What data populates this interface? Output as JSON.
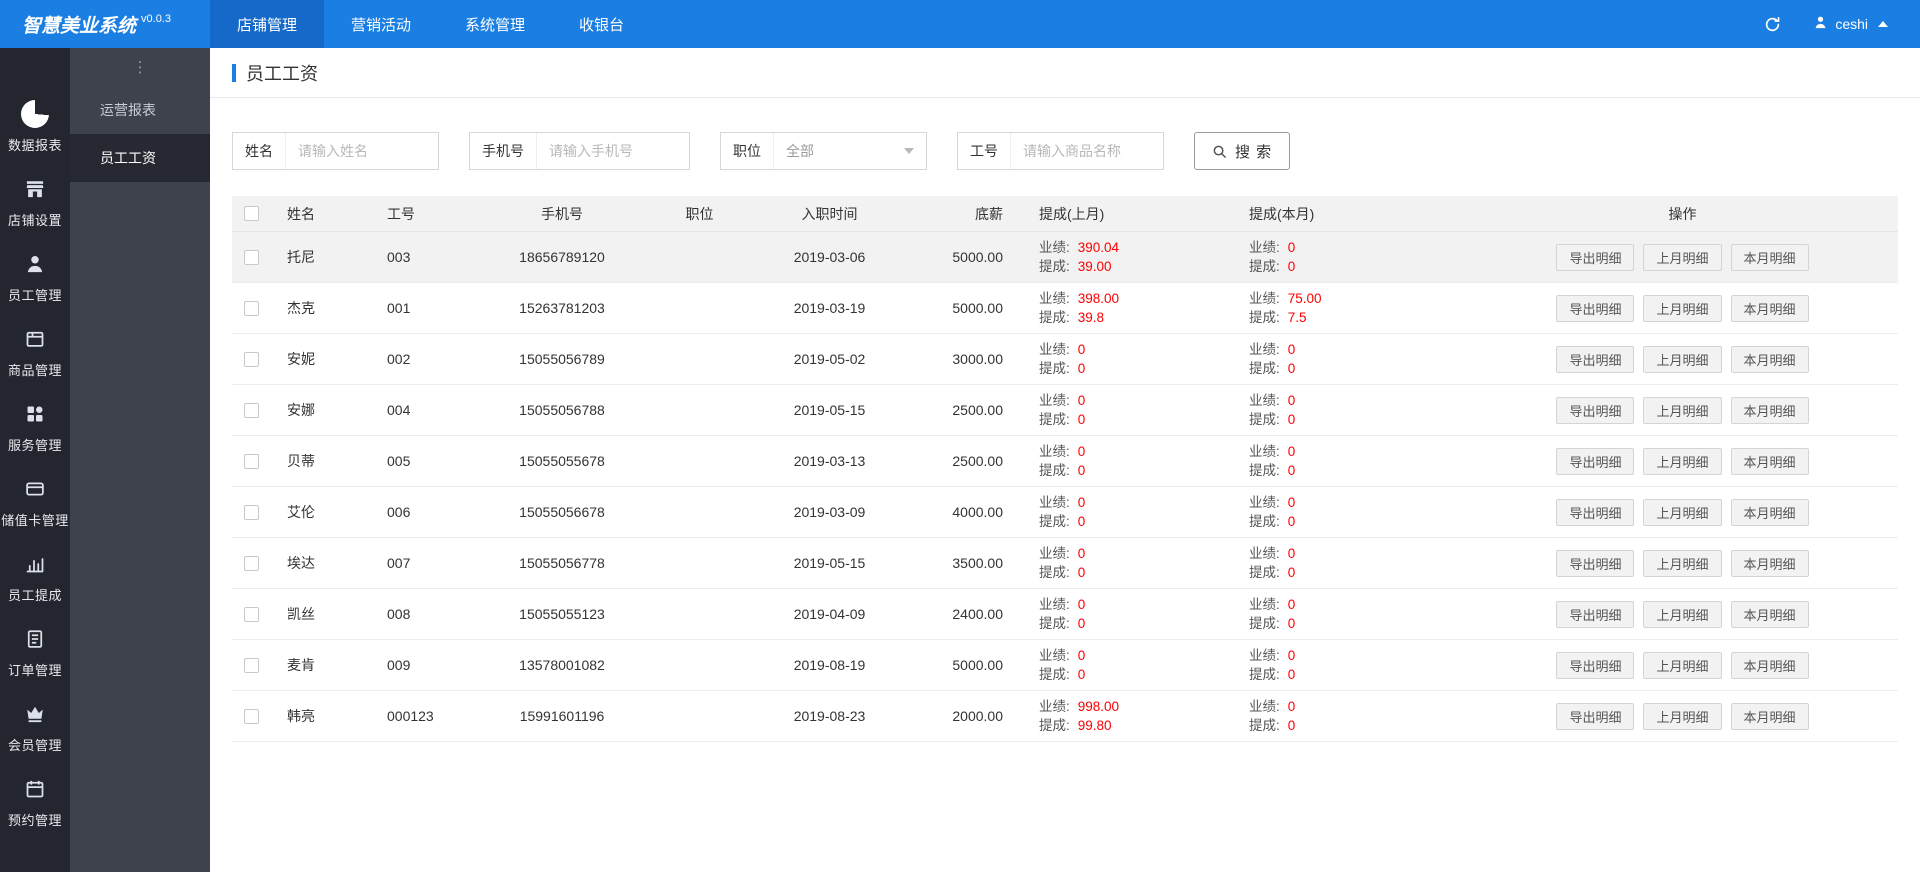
{
  "app": {
    "title": "智慧美业系统",
    "version": "v0.0.3",
    "user": "ceshi"
  },
  "colors": {
    "primary": "#1a7ee2",
    "primary_dark": "#1469c9",
    "sidebar_bg": "#23262e",
    "submenu_bg": "#3d424d",
    "danger_value": "#ff0000",
    "table_header_bg": "#f2f2f2"
  },
  "topnav": {
    "items": [
      {
        "label": "店铺管理",
        "active": true
      },
      {
        "label": "营销活动",
        "active": false
      },
      {
        "label": "系统管理",
        "active": false
      },
      {
        "label": "收银台",
        "active": false
      }
    ]
  },
  "sidebar": {
    "items": [
      {
        "key": "data-reports",
        "label": "数据报表",
        "icon": "pie-chart-icon",
        "active": true
      },
      {
        "key": "shop-settings",
        "label": "店铺设置",
        "icon": "shop-icon",
        "active": false
      },
      {
        "key": "staff-management",
        "label": "员工管理",
        "icon": "staff-icon",
        "active": false
      },
      {
        "key": "goods-management",
        "label": "商品管理",
        "icon": "goods-icon",
        "active": false
      },
      {
        "key": "service-management",
        "label": "服务管理",
        "icon": "services-grid-icon",
        "active": false
      },
      {
        "key": "stored-value-card",
        "label": "储值卡管理",
        "icon": "stored-value-card-icon",
        "active": false
      },
      {
        "key": "staff-commission",
        "label": "员工提成",
        "icon": "commission-chart-icon",
        "active": false
      },
      {
        "key": "order-management",
        "label": "订单管理",
        "icon": "order-icon",
        "active": false
      },
      {
        "key": "member-management",
        "label": "会员管理",
        "icon": "member-crown-icon",
        "active": false
      },
      {
        "key": "appointment-management",
        "label": "预约管理",
        "icon": "appointment-calendar-icon",
        "active": false
      }
    ]
  },
  "submenu": {
    "more": "⋮",
    "items": [
      {
        "label": "运营报表",
        "active": false
      },
      {
        "label": "员工工资",
        "active": true
      }
    ]
  },
  "page": {
    "title": "员工工资"
  },
  "filters": {
    "name_label": "姓名",
    "name_placeholder": "请输入姓名",
    "phone_label": "手机号",
    "phone_placeholder": "请输入手机号",
    "position_label": "职位",
    "position_value": "全部",
    "jobno_label": "工号",
    "jobno_placeholder": "请输入商品名称",
    "search_label": "搜 索"
  },
  "table": {
    "headers": [
      "姓名",
      "工号",
      "手机号",
      "职位",
      "入职时间",
      "底薪",
      "提成(上月)",
      "提成(本月)",
      "操作"
    ],
    "perf_label": "业绩:",
    "comm_label": "提成:",
    "actions": [
      "导出明细",
      "上月明细",
      "本月明细"
    ],
    "rows": [
      {
        "name": "托尼",
        "job_no": "003",
        "phone": "18656789120",
        "position": "",
        "hire_date": "2019-03-06",
        "base_salary": "5000.00",
        "last_perf": "390.04",
        "last_comm": "39.00",
        "cur_perf": "0",
        "cur_comm": "0",
        "shaded": true
      },
      {
        "name": "杰克",
        "job_no": "001",
        "phone": "15263781203",
        "position": "",
        "hire_date": "2019-03-19",
        "base_salary": "5000.00",
        "last_perf": "398.00",
        "last_comm": "39.8",
        "cur_perf": "75.00",
        "cur_comm": "7.5",
        "shaded": false
      },
      {
        "name": "安妮",
        "job_no": "002",
        "phone": "15055056789",
        "position": "",
        "hire_date": "2019-05-02",
        "base_salary": "3000.00",
        "last_perf": "0",
        "last_comm": "0",
        "cur_perf": "0",
        "cur_comm": "0",
        "shaded": false
      },
      {
        "name": "安娜",
        "job_no": "004",
        "phone": "15055056788",
        "position": "",
        "hire_date": "2019-05-15",
        "base_salary": "2500.00",
        "last_perf": "0",
        "last_comm": "0",
        "cur_perf": "0",
        "cur_comm": "0",
        "shaded": false
      },
      {
        "name": "贝蒂",
        "job_no": "005",
        "phone": "15055055678",
        "position": "",
        "hire_date": "2019-03-13",
        "base_salary": "2500.00",
        "last_perf": "0",
        "last_comm": "0",
        "cur_perf": "0",
        "cur_comm": "0",
        "shaded": false
      },
      {
        "name": "艾伦",
        "job_no": "006",
        "phone": "15055056678",
        "position": "",
        "hire_date": "2019-03-09",
        "base_salary": "4000.00",
        "last_perf": "0",
        "last_comm": "0",
        "cur_perf": "0",
        "cur_comm": "0",
        "shaded": false
      },
      {
        "name": "埃达",
        "job_no": "007",
        "phone": "15055056778",
        "position": "",
        "hire_date": "2019-05-15",
        "base_salary": "3500.00",
        "last_perf": "0",
        "last_comm": "0",
        "cur_perf": "0",
        "cur_comm": "0",
        "shaded": false
      },
      {
        "name": "凯丝",
        "job_no": "008",
        "phone": "15055055123",
        "position": "",
        "hire_date": "2019-04-09",
        "base_salary": "2400.00",
        "last_perf": "0",
        "last_comm": "0",
        "cur_perf": "0",
        "cur_comm": "0",
        "shaded": false
      },
      {
        "name": "麦肯",
        "job_no": "009",
        "phone": "13578001082",
        "position": "",
        "hire_date": "2019-08-19",
        "base_salary": "5000.00",
        "last_perf": "0",
        "last_comm": "0",
        "cur_perf": "0",
        "cur_comm": "0",
        "shaded": false
      },
      {
        "name": "韩亮",
        "job_no": "000123",
        "phone": "15991601196",
        "position": "",
        "hire_date": "2019-08-23",
        "base_salary": "2000.00",
        "last_perf": "998.00",
        "last_comm": "99.80",
        "cur_perf": "0",
        "cur_comm": "0",
        "shaded": false
      }
    ]
  }
}
